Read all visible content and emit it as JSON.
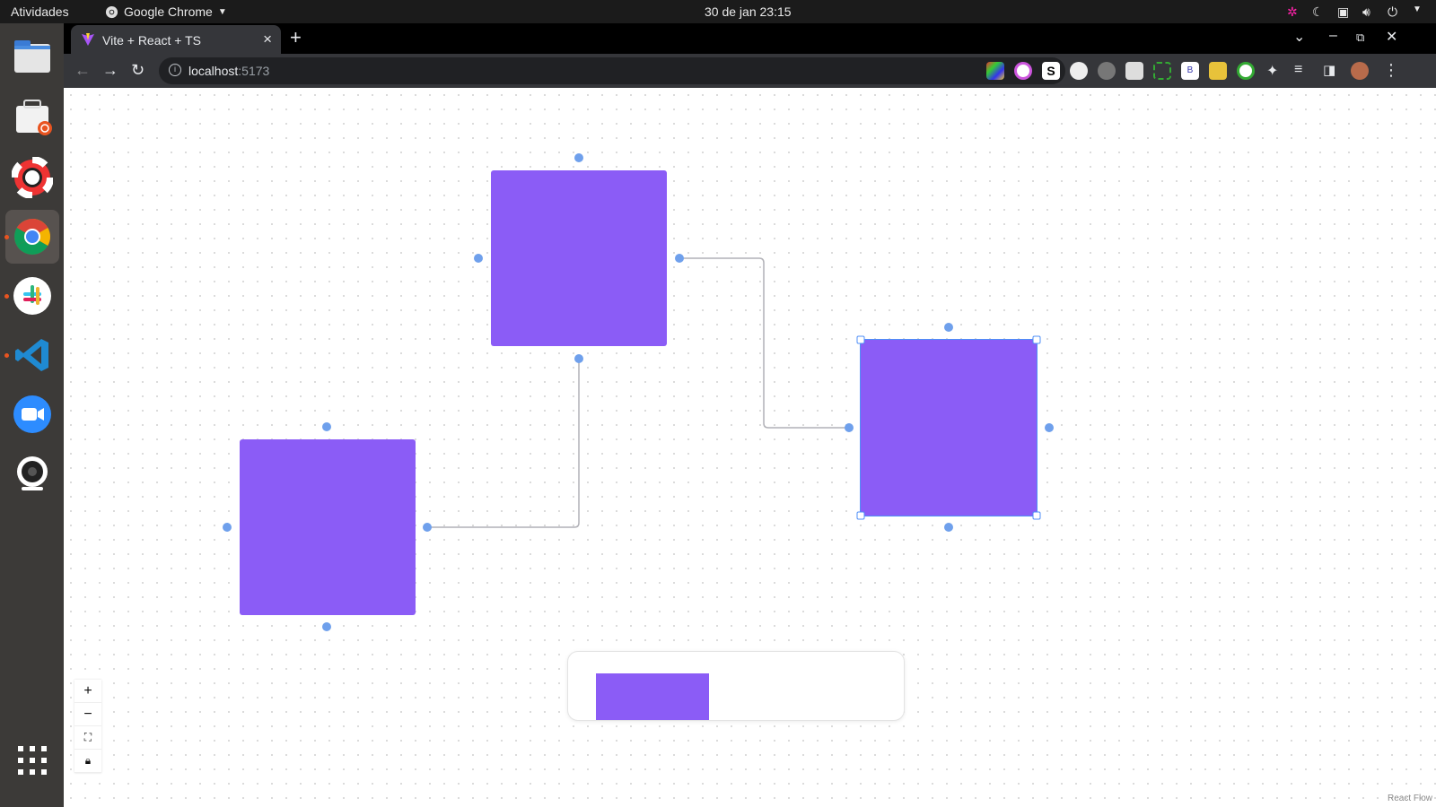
{
  "topbar": {
    "activities": "Atividades",
    "app_name": "Google Chrome",
    "clock": "30 de jan  23:15"
  },
  "dock": {
    "items": [
      "files-icon",
      "software-center-icon",
      "help-icon",
      "chrome-icon",
      "slack-icon",
      "vscode-icon",
      "zoom-icon",
      "webcam-icon",
      "app-grid-icon"
    ]
  },
  "browser": {
    "tab_title": "Vite + React + TS",
    "url_host": "localhost",
    "url_port": ":5173"
  },
  "canvas": {
    "node_color": "#8b5cf6",
    "handle_color": "#6fa0ec",
    "selection_color": "#4f8ff7",
    "attribution": "React Flow",
    "controls": [
      "zoom-in",
      "zoom-out",
      "fit-view",
      "lock"
    ]
  }
}
